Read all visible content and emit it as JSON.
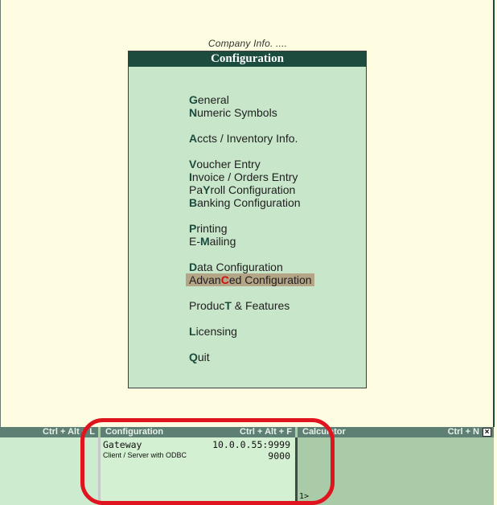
{
  "company_info": "Company Info. ....",
  "menu": {
    "title": "Configuration",
    "items": [
      {
        "hk": "G",
        "rest": "eneral"
      },
      {
        "hk": "N",
        "rest": "umeric Symbols"
      },
      {
        "hk": "A",
        "rest": "ccts / Inventory Info."
      },
      {
        "hk": "V",
        "rest": "oucher Entry"
      },
      {
        "hk": "I",
        "rest": "nvoice / Orders Entry"
      },
      {
        "pre": "Pa",
        "hk": "Y",
        "rest": "roll Configuration"
      },
      {
        "hk": "B",
        "rest": "anking Configuration"
      },
      {
        "hk": "P",
        "rest": "rinting"
      },
      {
        "pre": "E-",
        "hk": "M",
        "rest": "ailing"
      },
      {
        "hk": "D",
        "rest": "ata Configuration"
      },
      {
        "pre": "Advan",
        "hk": "C",
        "rest": "ed Configuration"
      },
      {
        "pre": "Produc",
        "hk": "T",
        "rest": " & Features"
      },
      {
        "hk": "L",
        "rest": "icensing"
      },
      {
        "hk": "Q",
        "rest": "uit"
      }
    ],
    "selected_item": "AdvanCed Configuration"
  },
  "bottom": {
    "left_header_keys": "Ctrl + Alt + L",
    "config_header_title": "Configuration",
    "config_header_keys": "Ctrl + Alt + F",
    "calc_header_title": "Calculator",
    "calc_header_keys": "Ctrl + N",
    "gateway_label": "Gateway",
    "gateway_value": "10.0.0.55:9999",
    "client_server_label": "Client / Server with ODBC",
    "client_server_value": "9000",
    "calc_prompt": "1>",
    "close_glyph": "×"
  },
  "colors": {
    "background": "#fffde1",
    "menu_bg": "#c8e6ca",
    "menu_title_bg": "#1b4c3e",
    "selected_bg": "#b3a586",
    "hotkey_selected": "#d01010",
    "annotation": "#e0141e"
  }
}
